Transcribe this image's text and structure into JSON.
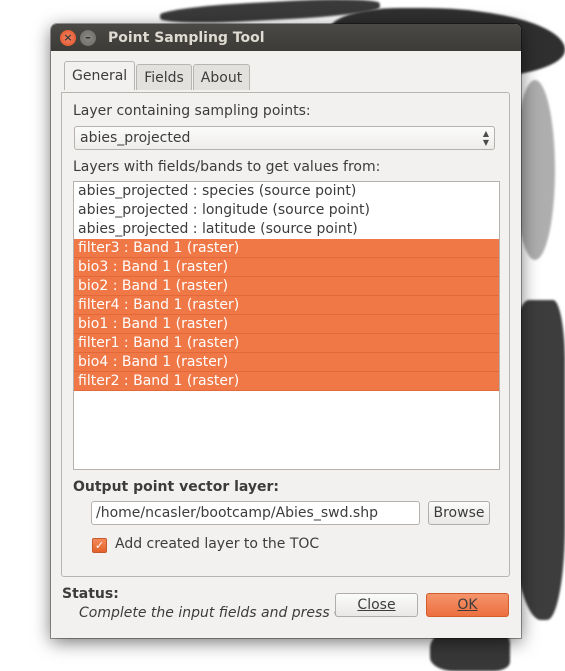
{
  "window": {
    "title": "Point Sampling Tool",
    "close_glyph": "×",
    "minimize_glyph": "–"
  },
  "tabs": [
    {
      "label": "General",
      "active": true
    },
    {
      "label": "Fields",
      "active": false
    },
    {
      "label": "About",
      "active": false
    }
  ],
  "general": {
    "sampling_label": "Layer containing sampling points:",
    "sampling_value": "abies_projected",
    "fields_label": "Layers with fields/bands to get values from:",
    "layers": [
      {
        "text": "abies_projected : species (source point)",
        "selected": false
      },
      {
        "text": "abies_projected : longitude (source point)",
        "selected": false
      },
      {
        "text": "abies_projected : latitude (source point)",
        "selected": false
      },
      {
        "text": "filter3 : Band 1 (raster)",
        "selected": true
      },
      {
        "text": "bio3 : Band 1 (raster)",
        "selected": true
      },
      {
        "text": "bio2 : Band 1 (raster)",
        "selected": true
      },
      {
        "text": "filter4 : Band 1 (raster)",
        "selected": true
      },
      {
        "text": "bio1 : Band 1 (raster)",
        "selected": true
      },
      {
        "text": "filter1 : Band 1 (raster)",
        "selected": true
      },
      {
        "text": "bio4 : Band 1 (raster)",
        "selected": true
      },
      {
        "text": "filter2 : Band 1 (raster)",
        "selected": true
      }
    ],
    "output_label": "Output point vector layer:",
    "output_path": "/home/ncasler/bootcamp/Abies_swd.shp",
    "browse_label": "Browse",
    "add_toc_label": "Add created layer to the TOC",
    "add_toc_checked": true
  },
  "status": {
    "label": "Status:",
    "message": "Complete the input fields and press OK"
  },
  "buttons": {
    "close_label": "Close",
    "ok_label": "OK"
  },
  "colors": {
    "selection": "#f07746",
    "titlebar": "#3c3b37",
    "accent_button": "#ec6f3f"
  }
}
